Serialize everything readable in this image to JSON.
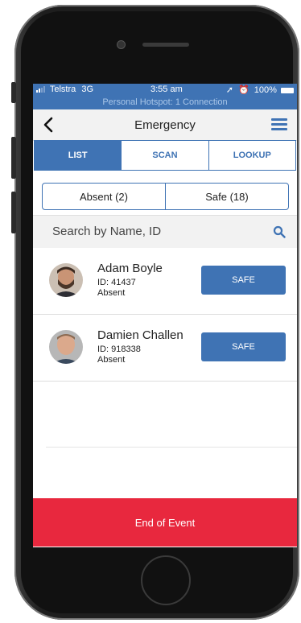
{
  "status_bar": {
    "carrier": "Telstra",
    "network": "3G",
    "time": "3:55 am",
    "battery": "100%",
    "hotspot": "Personal Hotspot: 1 Connection"
  },
  "nav": {
    "title": "Emergency"
  },
  "tabs": [
    {
      "label": "LIST",
      "active": true
    },
    {
      "label": "SCAN",
      "active": false
    },
    {
      "label": "LOOKUP",
      "active": false
    }
  ],
  "segments": [
    {
      "label": "Absent (2)"
    },
    {
      "label": "Safe (18)"
    }
  ],
  "search": {
    "placeholder": "Search by Name, ID"
  },
  "people": [
    {
      "name": "Adam Boyle",
      "id_text": "ID: 41437",
      "status": "Absent",
      "action": "SAFE"
    },
    {
      "name": "Damien Challen",
      "id_text": "ID: 918338",
      "status": "Absent",
      "action": "SAFE"
    }
  ],
  "footer": {
    "end_event_label": "End of Event"
  },
  "colors": {
    "primary": "#3f73b4",
    "danger": "#e8283e"
  }
}
